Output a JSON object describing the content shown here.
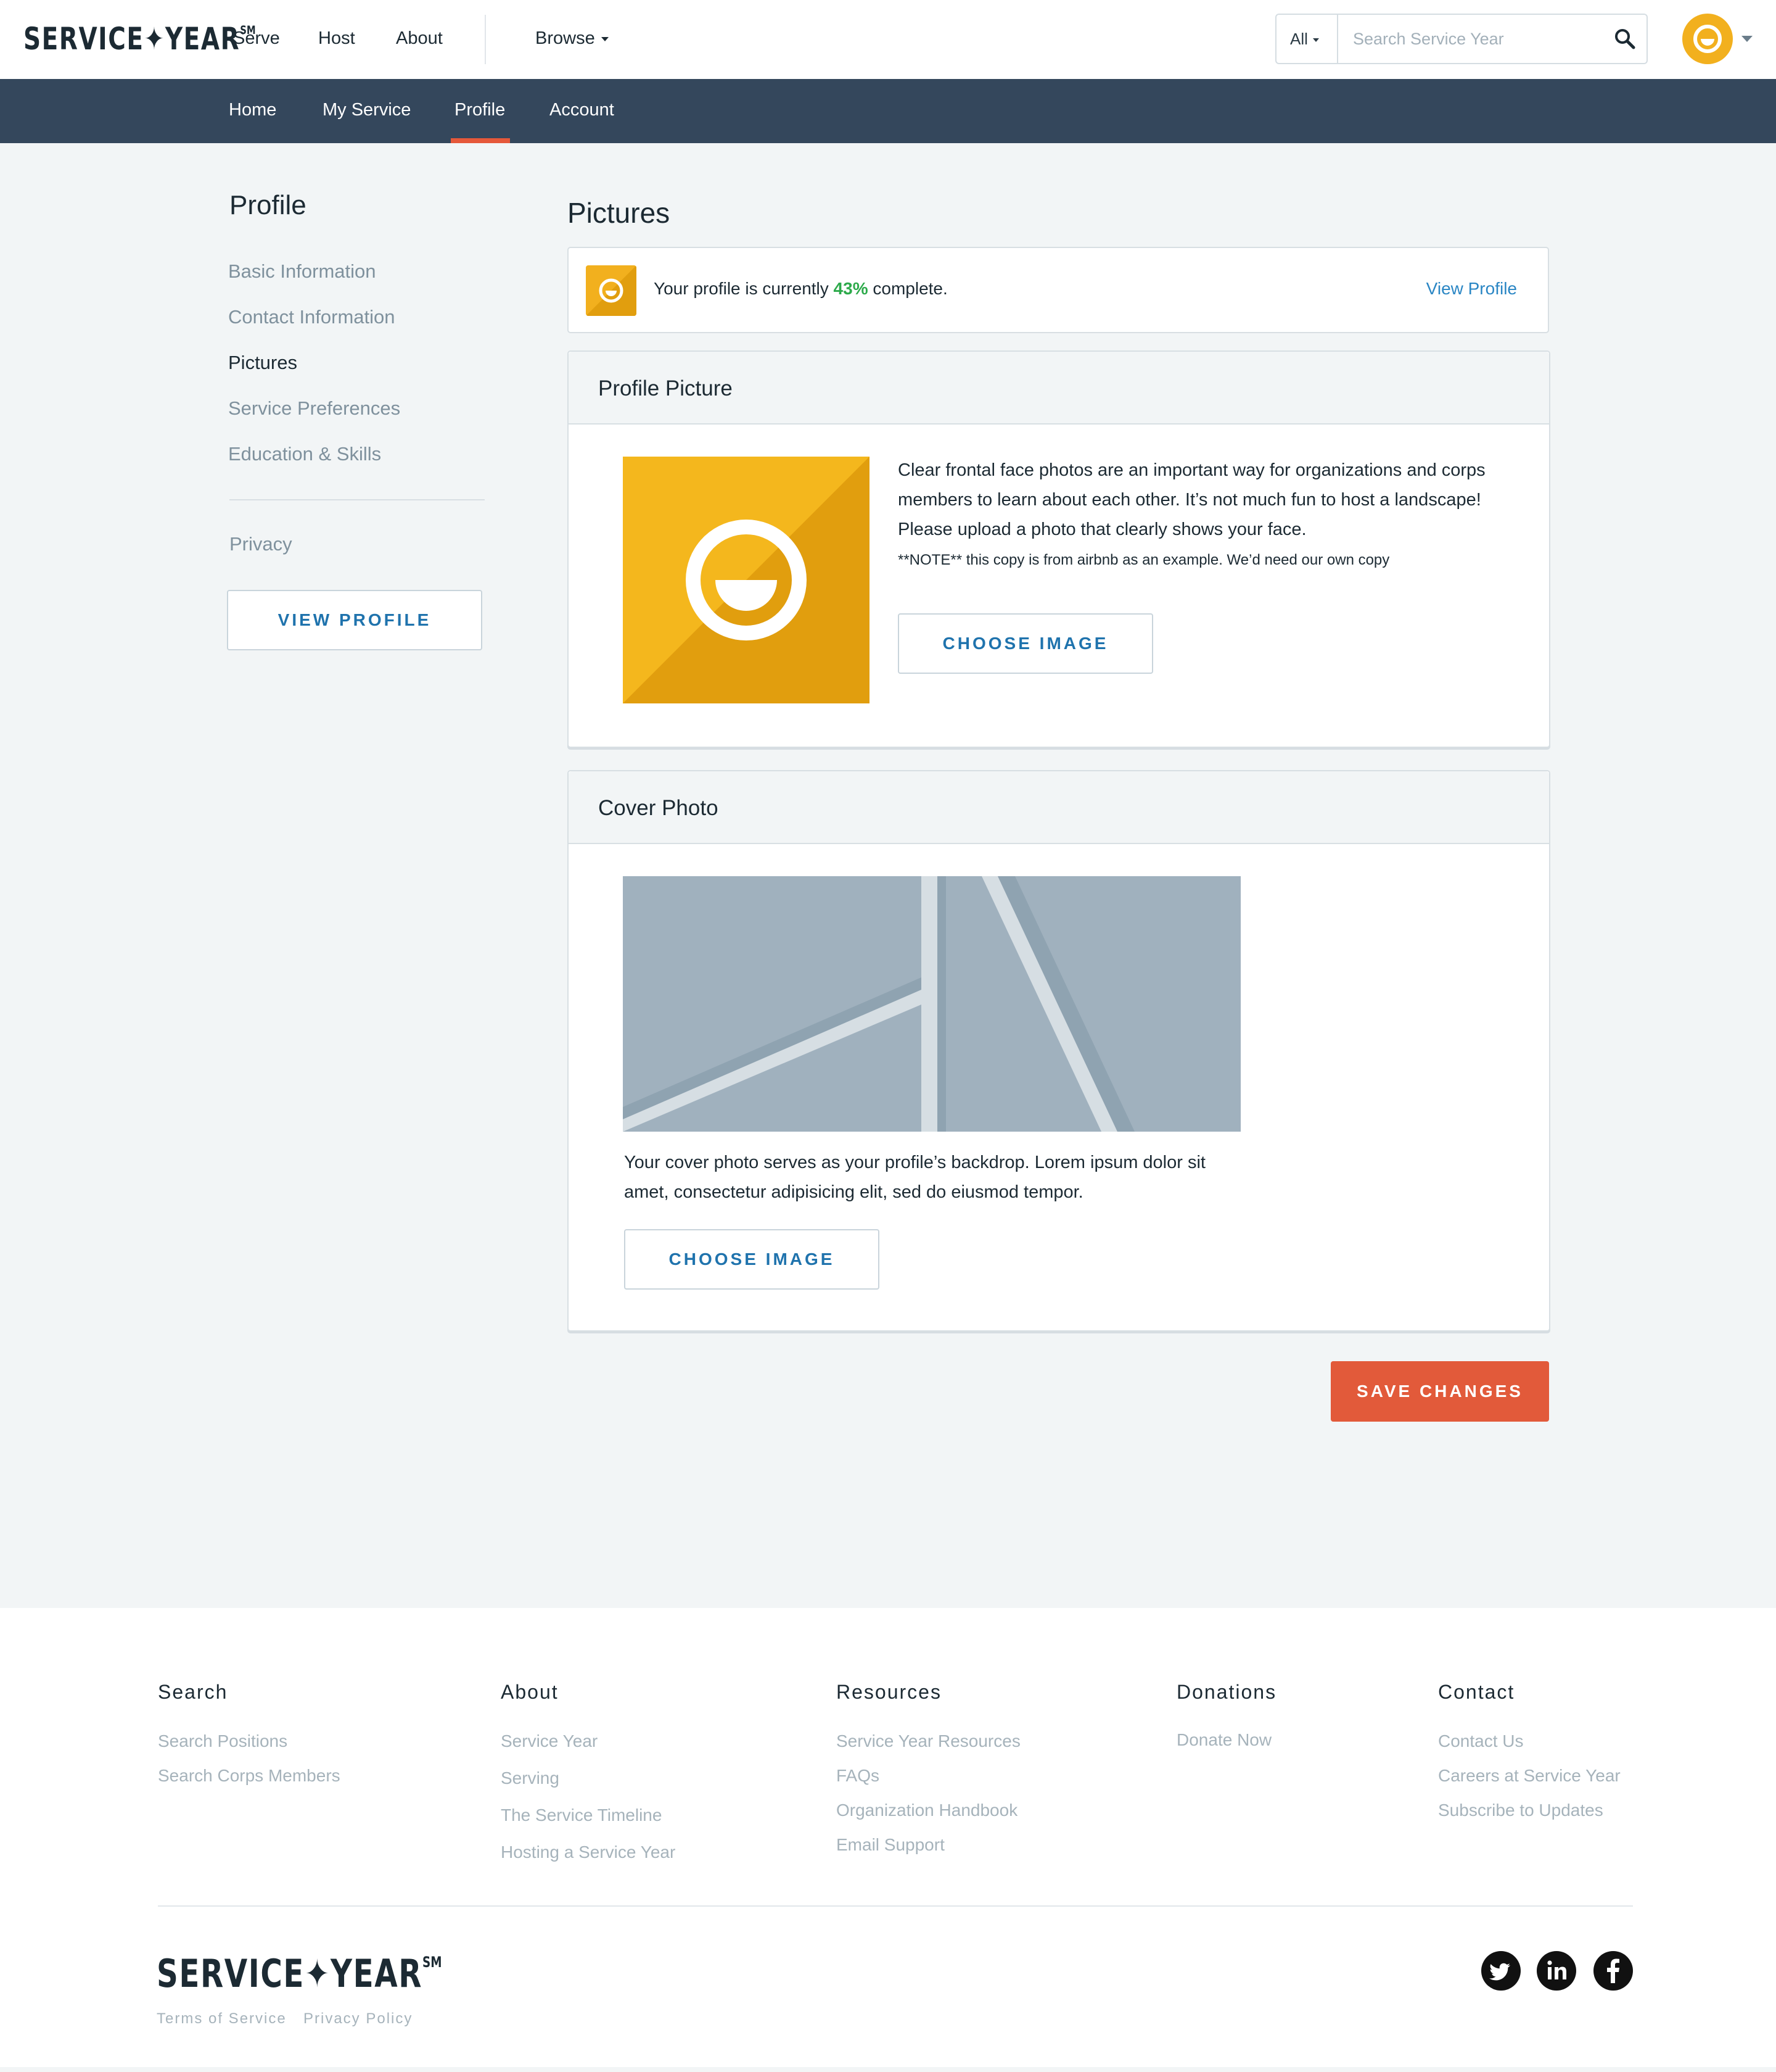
{
  "header": {
    "logo": "SERVICE✦YEAR",
    "logo_mark": "SM",
    "nav": {
      "serve": "Serve",
      "host": "Host",
      "about": "About",
      "browse": "Browse"
    },
    "search": {
      "scope": "All",
      "placeholder": "Search Service Year"
    }
  },
  "subnav": {
    "home": "Home",
    "my_service": "My Service",
    "profile": "Profile",
    "account": "Account",
    "active": "Profile"
  },
  "sidebar": {
    "title": "Profile",
    "items": [
      {
        "label": "Basic Information"
      },
      {
        "label": "Contact Information"
      },
      {
        "label": "Pictures"
      },
      {
        "label": "Service Preferences"
      },
      {
        "label": "Education & Skills"
      },
      {
        "label": "Privacy"
      }
    ],
    "active_item": "Pictures",
    "view_profile_button": "VIEW PROFILE"
  },
  "main": {
    "title": "Pictures",
    "progress": {
      "prefix": "Your profile is currently",
      "percent": "43%",
      "suffix": "complete.",
      "link": "View Profile"
    },
    "profile_picture": {
      "title": "Profile Picture",
      "description": "Clear frontal face photos are an important way for organizations and corps members to learn about each other. It’s not much fun to host a landscape! Please upload a photo that clearly shows your face.",
      "note": "**NOTE** this copy is from airbnb as an example. We’d need our own copy",
      "button": "CHOOSE IMAGE"
    },
    "cover_photo": {
      "title": "Cover Photo",
      "description": "Your cover photo serves as your profile’s backdrop. Lorem ipsum dolor sit amet, consectetur adipisicing elit, sed do eiusmod tempor.",
      "button": "CHOOSE IMAGE"
    },
    "save_button": "SAVE CHANGES"
  },
  "footer": {
    "columns": [
      {
        "heading": "Search",
        "links": [
          "Search Positions",
          "Search Corps Members"
        ]
      },
      {
        "heading": "About",
        "links": [
          "Service Year",
          "Serving",
          "The Service Timeline",
          "Hosting a Service Year"
        ]
      },
      {
        "heading": "Resources",
        "links": [
          "Service Year Resources",
          "FAQs",
          "Organization Handbook",
          "Email Support"
        ]
      },
      {
        "heading": "Donations",
        "links": [
          "Donate Now"
        ]
      },
      {
        "heading": "Contact",
        "links": [
          "Contact Us",
          "Careers at Service Year",
          "Subscribe to Updates"
        ]
      }
    ],
    "logo": "SERVICE✦YEAR",
    "logo_mark": "SM",
    "legal": {
      "terms": "Terms of Service",
      "privacy": "Privacy Policy"
    },
    "social": [
      "twitter-icon",
      "linkedin-icon",
      "facebook-icon"
    ]
  },
  "colors": {
    "brand_yellow": "#f2b01e",
    "accent_orange": "#e25a3a",
    "nav_dark": "#34475c",
    "link_blue": "#1f73ad",
    "success_green": "#2daa4b"
  }
}
